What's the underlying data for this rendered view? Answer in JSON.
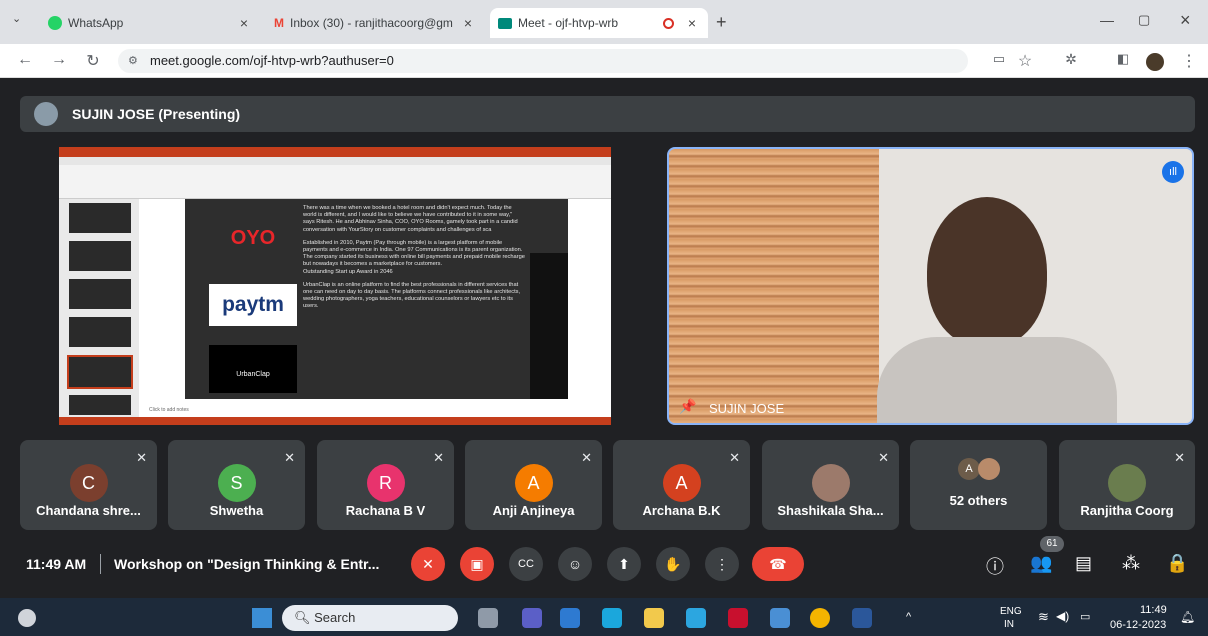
{
  "tabs": [
    {
      "title": "WhatsApp",
      "icon": "whatsapp-icon"
    },
    {
      "title": "Inbox (30) - ranjithacoorg@gm",
      "icon": "gmail-icon"
    },
    {
      "title": "Meet - ojf-htvp-wrb",
      "icon": "meet-icon"
    }
  ],
  "url": "meet.google.com/ojf-htvp-wrb?authuser=0",
  "presenter": "SUJIN JOSE (Presenting)",
  "speaker_label": "SUJIN JOSE",
  "slide": {
    "p1": "There was a time when we booked a hotel room and didn't expect much. Today the world is different, and I would like to believe we have contributed to it in some way,\" says Ritesh. He and Abhinav Sinha, COO, OYO Rooms, gamely took part in a candid conversation with YourStory on customer complaints and challenges of sca",
    "p2": "Established in 2010, Paytm (Pay through mobile) is a largest platform of mobile payments and e-commerce in India. One 97 Communications is its parent organization. The company started its business with online bill payments and prepaid mobile recharge but nowadays it becomes a marketplace for customers.",
    "p2b": "Outstanding Start up Award in 2046",
    "p3": "UrbanClap is an online platform to find the best professionals in different services that one can need on day to day basis. The platforms connect professionals like architects, wedding photographers, yoga teachers, educational counselors or lawyers etc to its users.",
    "logo1": "OYO",
    "logo2": "paytm",
    "logo3": "UrbanClap",
    "notes": "Click to add notes"
  },
  "participants": [
    {
      "initial": "C",
      "name": "Chandana shre...",
      "color": "#7b3f2e"
    },
    {
      "initial": "S",
      "name": "Shwetha",
      "color": "#4caf50"
    },
    {
      "initial": "R",
      "name": "Rachana B V",
      "color": "#e8336d"
    },
    {
      "initial": "A",
      "name": "Anji Anjineya",
      "color": "#f57c00"
    },
    {
      "initial": "A",
      "name": "Archana B.K",
      "color": "#d4411f"
    },
    {
      "initial": "",
      "name": "Shashikala Sha...",
      "color": "#9c7a6b"
    },
    {
      "initial": "A",
      "name": "52 others",
      "color": "#6d5c4a"
    },
    {
      "initial": "",
      "name": "Ranjitha Coorg",
      "color": "#6a7d4e"
    }
  ],
  "time": "11:49 AM",
  "meeting_title": "Workshop on \"Design Thinking & Entr...",
  "people_count": "61",
  "search": "Search",
  "tray": {
    "lang": "ENG",
    "region": "IN",
    "clock": "11:49",
    "date": "06-12-2023"
  }
}
